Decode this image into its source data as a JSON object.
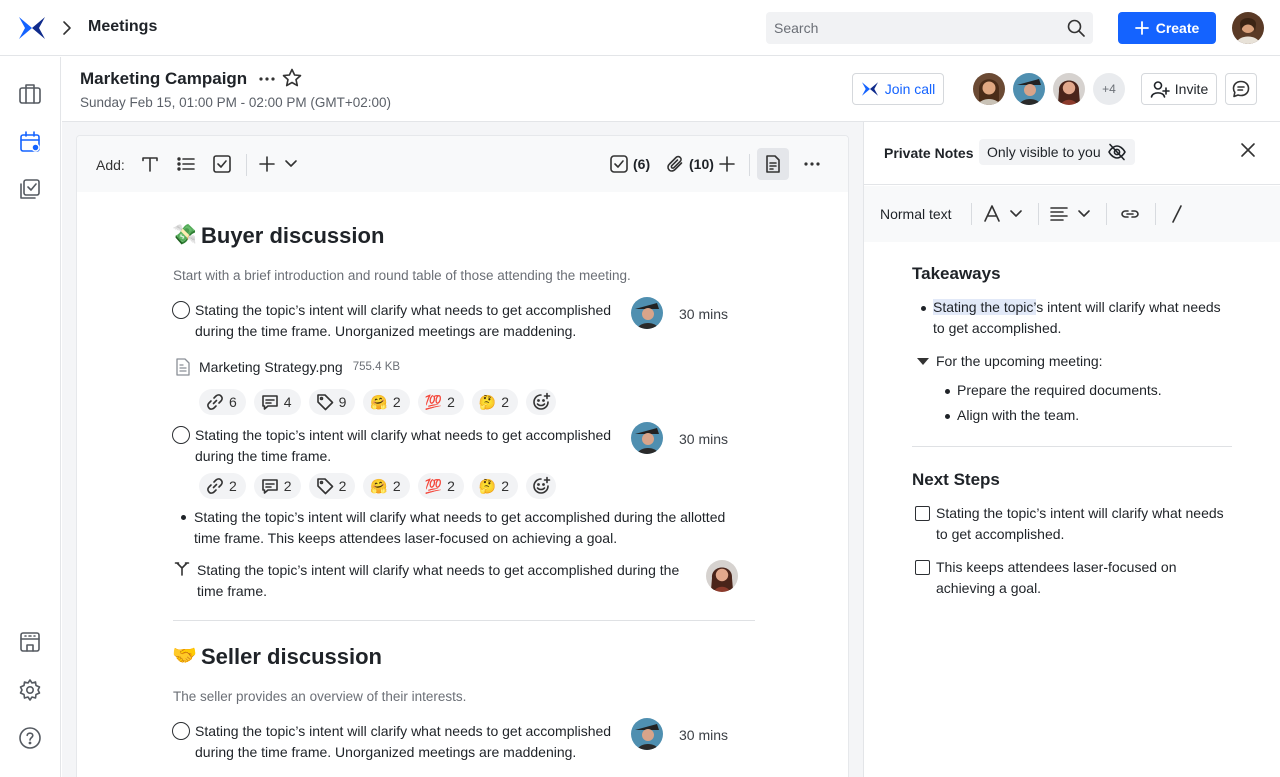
{
  "topbar": {
    "breadcrumb": "Meetings",
    "search_placeholder": "Search",
    "create_label": "Create"
  },
  "meeting": {
    "title": "Marketing Campaign",
    "datetime": "Sunday Feb 15, 01:00 PM - 02:00 PM (GMT+02:00)",
    "join_label": "Join call",
    "more_attendees": "+4",
    "invite_label": "Invite"
  },
  "toolbar": {
    "add_label": "Add:",
    "tasks_count": "(6)",
    "attachments_count": "(10)"
  },
  "sections": [
    {
      "emoji": "💸",
      "title": "Buyer discussion",
      "description": "Start with a brief introduction and round table of those attending the meeting.",
      "items": [
        {
          "text": "Stating the topic’s intent will clarify what needs to get accomplished during the time frame. Unorganized meetings are maddening.",
          "duration": "30 mins"
        },
        {
          "text": "Stating the topic’s intent will clarify what needs to get accomplished during the time frame.",
          "duration": "30 mins"
        }
      ],
      "attachment": {
        "name": "Marketing Strategy.png",
        "size": "755.4 KB"
      },
      "reactions_1": [
        {
          "icon": "link-icon",
          "count": "6"
        },
        {
          "icon": "comment-icon",
          "count": "4"
        },
        {
          "icon": "tag-icon",
          "count": "9"
        },
        {
          "emoji": "🤗",
          "count": "2"
        },
        {
          "emoji": "💯",
          "count": "2"
        },
        {
          "emoji": "🤔",
          "count": "2"
        }
      ],
      "reactions_2": [
        {
          "icon": "link-icon",
          "count": "2"
        },
        {
          "icon": "comment-icon",
          "count": "2"
        },
        {
          "icon": "tag-icon",
          "count": "2"
        },
        {
          "emoji": "🤗",
          "count": "2"
        },
        {
          "emoji": "💯",
          "count": "2"
        },
        {
          "emoji": "🤔",
          "count": "2"
        }
      ],
      "bullet": "Stating the topic’s intent will clarify what needs to get accomplished during the allotted time frame. This keeps attendees laser-focused on achieving a goal.",
      "decision": "Stating the topic’s intent will clarify what needs to get accomplished during the time frame."
    },
    {
      "emoji": "🤝",
      "title": "Seller discussion",
      "description": "The seller provides an overview of their interests.",
      "items": [
        {
          "text": "Stating the topic’s intent will clarify what needs to get accomplished during the time frame. Unorganized meetings are maddening.",
          "duration": "30 mins"
        }
      ]
    }
  ],
  "private_notes": {
    "title": "Private Notes",
    "visibility": "Only visible to you",
    "format_label": "Normal text",
    "takeaways_heading": "Takeaways",
    "takeaway_highlight": "Stating the topic’",
    "takeaway_rest": "s intent will clarify what needs to get accomplished.",
    "upcoming_label": "For the upcoming meeting:",
    "upcoming_items": [
      "Prepare the required documents.",
      "Align with the team."
    ],
    "next_steps_heading": "Next Steps",
    "next_steps": [
      "Stating the topic’s intent will clarify what needs to get accomplished.",
      "This keeps attendees laser-focused on achieving a goal."
    ]
  },
  "colors": {
    "accent": "#1463ff",
    "highlight": "#e2e9f8",
    "surface": "#f4f5f7"
  }
}
